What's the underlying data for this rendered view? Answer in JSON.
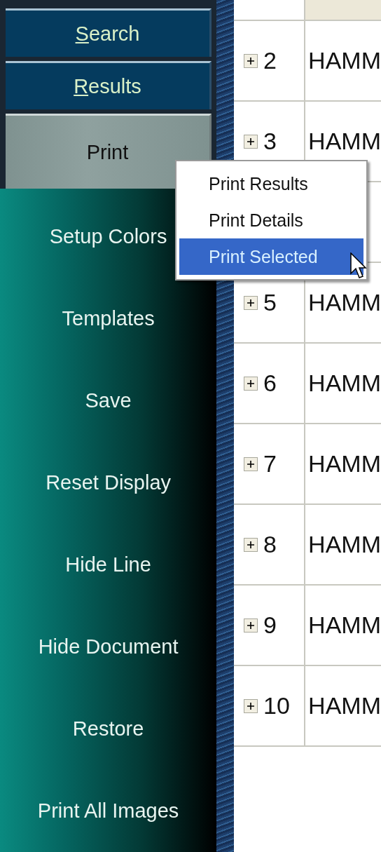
{
  "nav_buttons": [
    {
      "label": "Search",
      "underline_first": true,
      "pressed": false
    },
    {
      "label": "Results",
      "underline_first": true,
      "pressed": false
    },
    {
      "label": "Print",
      "underline_first": false,
      "pressed": true
    }
  ],
  "sidebar_items": [
    "Setup Colors",
    "Templates",
    "Save",
    "Reset Display",
    "Hide Line",
    "Hide Document",
    "Restore",
    "Print All Images"
  ],
  "table": {
    "rows": [
      {
        "kind": "record",
        "number": "2",
        "text": "HAMM"
      },
      {
        "kind": "record",
        "number": "3",
        "text": "HAMM"
      },
      {
        "kind": "covered"
      },
      {
        "kind": "record",
        "number": "5",
        "text": "HAMM"
      },
      {
        "kind": "record",
        "number": "6",
        "text": "HAMM"
      },
      {
        "kind": "record",
        "number": "7",
        "text": "HAMM"
      },
      {
        "kind": "record",
        "number": "8",
        "text": "HAMM"
      },
      {
        "kind": "record",
        "number": "9",
        "text": "HAMM"
      },
      {
        "kind": "record",
        "number": "10",
        "text": "HAMM"
      }
    ]
  },
  "print_menu": [
    {
      "label": "Print Results",
      "selected": false
    },
    {
      "label": "Print Details",
      "selected": false
    },
    {
      "label": "Print Selected",
      "selected": true
    }
  ]
}
